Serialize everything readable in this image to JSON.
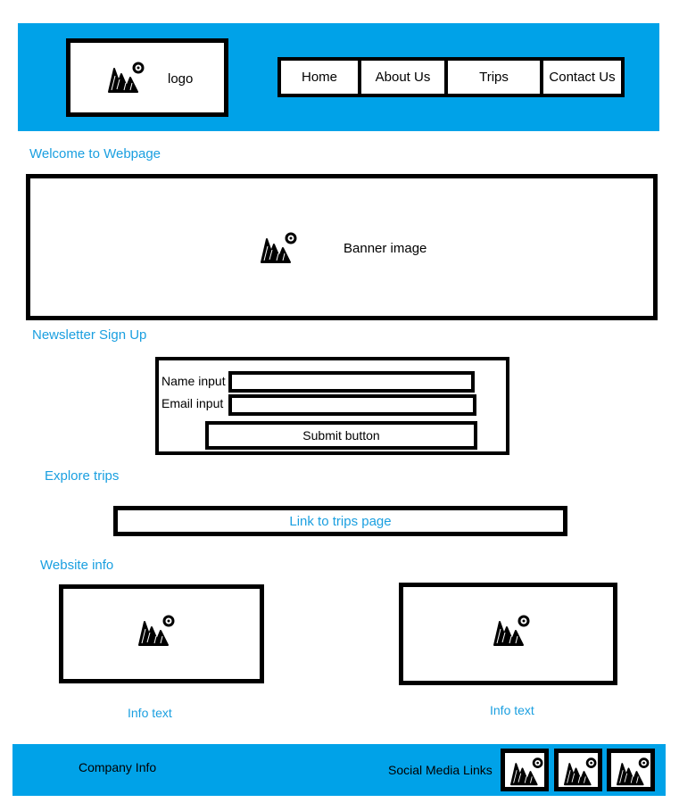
{
  "header": {
    "logo_label": "logo",
    "nav": [
      "Home",
      "About Us",
      "Trips",
      "Contact Us"
    ]
  },
  "welcome_label": "Welcome to Webpage",
  "banner_label": "Banner image",
  "newsletter": {
    "heading": "Newsletter Sign Up",
    "name_label": "Name input",
    "email_label": "Email input",
    "submit_label": "Submit button"
  },
  "explore": {
    "heading": "Explore trips",
    "link_label": "Link to trips page"
  },
  "info": {
    "heading": "Website info",
    "left_text": "Info text",
    "right_text": "Info text"
  },
  "footer": {
    "company_label": "Company Info",
    "social_label": "Social Media Links"
  },
  "colors": {
    "accent": "#00a2e8",
    "label_text": "#1a9fe0"
  },
  "icons": [
    "image-placeholder-icon"
  ]
}
